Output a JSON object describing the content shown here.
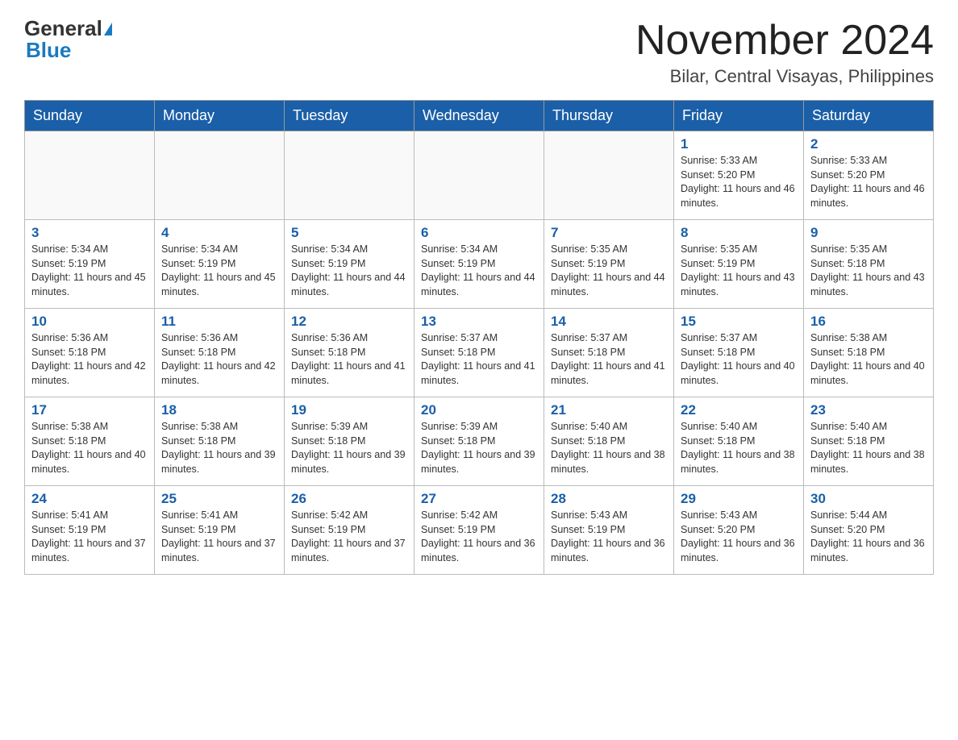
{
  "header": {
    "logo_general": "General",
    "logo_blue": "Blue",
    "month_title": "November 2024",
    "location": "Bilar, Central Visayas, Philippines"
  },
  "weekdays": [
    "Sunday",
    "Monday",
    "Tuesday",
    "Wednesday",
    "Thursday",
    "Friday",
    "Saturday"
  ],
  "weeks": [
    [
      {
        "day": "",
        "info": ""
      },
      {
        "day": "",
        "info": ""
      },
      {
        "day": "",
        "info": ""
      },
      {
        "day": "",
        "info": ""
      },
      {
        "day": "",
        "info": ""
      },
      {
        "day": "1",
        "info": "Sunrise: 5:33 AM\nSunset: 5:20 PM\nDaylight: 11 hours and 46 minutes."
      },
      {
        "day": "2",
        "info": "Sunrise: 5:33 AM\nSunset: 5:20 PM\nDaylight: 11 hours and 46 minutes."
      }
    ],
    [
      {
        "day": "3",
        "info": "Sunrise: 5:34 AM\nSunset: 5:19 PM\nDaylight: 11 hours and 45 minutes."
      },
      {
        "day": "4",
        "info": "Sunrise: 5:34 AM\nSunset: 5:19 PM\nDaylight: 11 hours and 45 minutes."
      },
      {
        "day": "5",
        "info": "Sunrise: 5:34 AM\nSunset: 5:19 PM\nDaylight: 11 hours and 44 minutes."
      },
      {
        "day": "6",
        "info": "Sunrise: 5:34 AM\nSunset: 5:19 PM\nDaylight: 11 hours and 44 minutes."
      },
      {
        "day": "7",
        "info": "Sunrise: 5:35 AM\nSunset: 5:19 PM\nDaylight: 11 hours and 44 minutes."
      },
      {
        "day": "8",
        "info": "Sunrise: 5:35 AM\nSunset: 5:19 PM\nDaylight: 11 hours and 43 minutes."
      },
      {
        "day": "9",
        "info": "Sunrise: 5:35 AM\nSunset: 5:18 PM\nDaylight: 11 hours and 43 minutes."
      }
    ],
    [
      {
        "day": "10",
        "info": "Sunrise: 5:36 AM\nSunset: 5:18 PM\nDaylight: 11 hours and 42 minutes."
      },
      {
        "day": "11",
        "info": "Sunrise: 5:36 AM\nSunset: 5:18 PM\nDaylight: 11 hours and 42 minutes."
      },
      {
        "day": "12",
        "info": "Sunrise: 5:36 AM\nSunset: 5:18 PM\nDaylight: 11 hours and 41 minutes."
      },
      {
        "day": "13",
        "info": "Sunrise: 5:37 AM\nSunset: 5:18 PM\nDaylight: 11 hours and 41 minutes."
      },
      {
        "day": "14",
        "info": "Sunrise: 5:37 AM\nSunset: 5:18 PM\nDaylight: 11 hours and 41 minutes."
      },
      {
        "day": "15",
        "info": "Sunrise: 5:37 AM\nSunset: 5:18 PM\nDaylight: 11 hours and 40 minutes."
      },
      {
        "day": "16",
        "info": "Sunrise: 5:38 AM\nSunset: 5:18 PM\nDaylight: 11 hours and 40 minutes."
      }
    ],
    [
      {
        "day": "17",
        "info": "Sunrise: 5:38 AM\nSunset: 5:18 PM\nDaylight: 11 hours and 40 minutes."
      },
      {
        "day": "18",
        "info": "Sunrise: 5:38 AM\nSunset: 5:18 PM\nDaylight: 11 hours and 39 minutes."
      },
      {
        "day": "19",
        "info": "Sunrise: 5:39 AM\nSunset: 5:18 PM\nDaylight: 11 hours and 39 minutes."
      },
      {
        "day": "20",
        "info": "Sunrise: 5:39 AM\nSunset: 5:18 PM\nDaylight: 11 hours and 39 minutes."
      },
      {
        "day": "21",
        "info": "Sunrise: 5:40 AM\nSunset: 5:18 PM\nDaylight: 11 hours and 38 minutes."
      },
      {
        "day": "22",
        "info": "Sunrise: 5:40 AM\nSunset: 5:18 PM\nDaylight: 11 hours and 38 minutes."
      },
      {
        "day": "23",
        "info": "Sunrise: 5:40 AM\nSunset: 5:18 PM\nDaylight: 11 hours and 38 minutes."
      }
    ],
    [
      {
        "day": "24",
        "info": "Sunrise: 5:41 AM\nSunset: 5:19 PM\nDaylight: 11 hours and 37 minutes."
      },
      {
        "day": "25",
        "info": "Sunrise: 5:41 AM\nSunset: 5:19 PM\nDaylight: 11 hours and 37 minutes."
      },
      {
        "day": "26",
        "info": "Sunrise: 5:42 AM\nSunset: 5:19 PM\nDaylight: 11 hours and 37 minutes."
      },
      {
        "day": "27",
        "info": "Sunrise: 5:42 AM\nSunset: 5:19 PM\nDaylight: 11 hours and 36 minutes."
      },
      {
        "day": "28",
        "info": "Sunrise: 5:43 AM\nSunset: 5:19 PM\nDaylight: 11 hours and 36 minutes."
      },
      {
        "day": "29",
        "info": "Sunrise: 5:43 AM\nSunset: 5:20 PM\nDaylight: 11 hours and 36 minutes."
      },
      {
        "day": "30",
        "info": "Sunrise: 5:44 AM\nSunset: 5:20 PM\nDaylight: 11 hours and 36 minutes."
      }
    ]
  ]
}
